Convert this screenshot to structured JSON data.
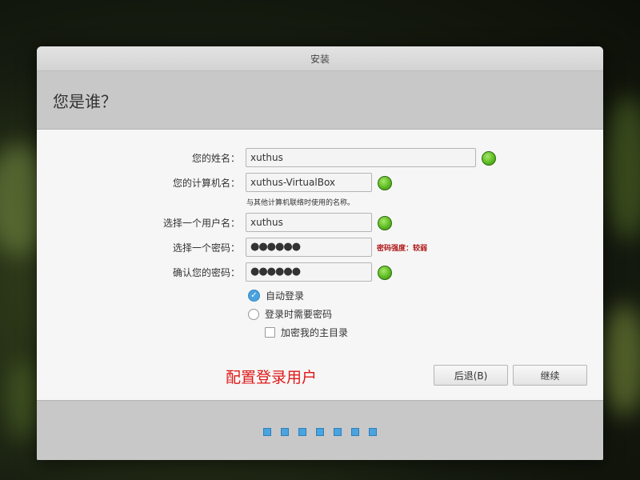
{
  "window": {
    "title": "安装"
  },
  "page": {
    "heading": "您是谁？"
  },
  "form": {
    "name_label": "您的姓名：",
    "name_value": "xuthus",
    "computer_label": "您的计算机名：",
    "computer_value": "xuthus-VirtualBox",
    "computer_hint": "与其他计算机联络时使用的名称。",
    "username_label": "选择一个用户名：",
    "username_value": "xuthus",
    "password_label": "选择一个密码：",
    "password_value": "●●●●●●",
    "password_strength": "密码强度：较弱",
    "confirm_label": "确认您的密码：",
    "confirm_value": "●●●●●●"
  },
  "options": {
    "auto_login": "自动登录",
    "require_password": "登录时需要密码",
    "encrypt_home": "加密我的主目录",
    "auto_login_checked": true
  },
  "section_title": "配置登录用户",
  "buttons": {
    "back": "后退(B)",
    "continue": "继续"
  },
  "progress": {
    "total_steps": 7
  },
  "colors": {
    "accent": "#4aa3df",
    "ok": "#5dbb22",
    "warning": "#b01818",
    "annotation": "#e01818"
  }
}
